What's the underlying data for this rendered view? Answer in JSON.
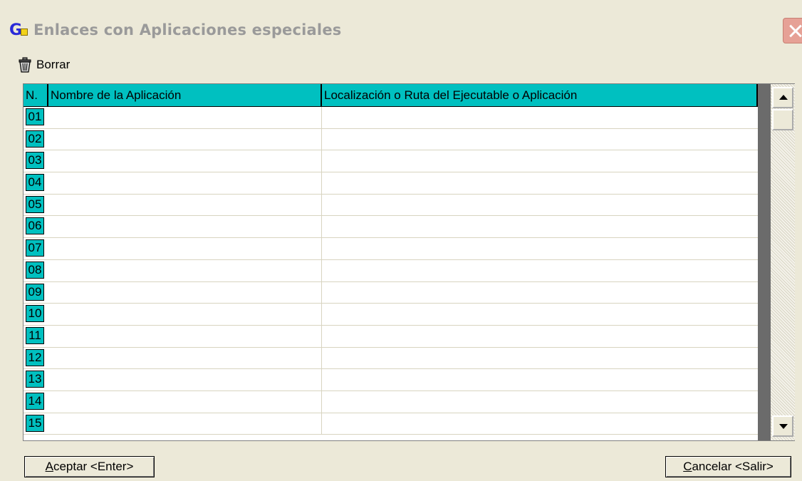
{
  "window": {
    "title": "Enlaces con Aplicaciones especiales",
    "icon": "app-logo-icon",
    "close_icon": "close-icon"
  },
  "toolbar": {
    "delete_label": "Borrar",
    "delete_icon": "trash-icon"
  },
  "table": {
    "headers": [
      "N.",
      "Nombre de la Aplicación",
      "Localización o Ruta del Ejecutable o Aplicación"
    ],
    "rows": [
      {
        "n": "01",
        "name": "",
        "path": ""
      },
      {
        "n": "02",
        "name": "",
        "path": ""
      },
      {
        "n": "03",
        "name": "",
        "path": ""
      },
      {
        "n": "04",
        "name": "",
        "path": ""
      },
      {
        "n": "05",
        "name": "",
        "path": ""
      },
      {
        "n": "06",
        "name": "",
        "path": ""
      },
      {
        "n": "07",
        "name": "",
        "path": ""
      },
      {
        "n": "08",
        "name": "",
        "path": ""
      },
      {
        "n": "09",
        "name": "",
        "path": ""
      },
      {
        "n": "10",
        "name": "",
        "path": ""
      },
      {
        "n": "11",
        "name": "",
        "path": ""
      },
      {
        "n": "12",
        "name": "",
        "path": ""
      },
      {
        "n": "13",
        "name": "",
        "path": ""
      },
      {
        "n": "14",
        "name": "",
        "path": ""
      },
      {
        "n": "15",
        "name": "",
        "path": ""
      }
    ],
    "header_color": "#00C0C0"
  },
  "buttons": {
    "accept_key": "A",
    "accept_rest": "ceptar <Enter>",
    "cancel_key": "C",
    "cancel_rest": "ancelar <Salir>"
  }
}
